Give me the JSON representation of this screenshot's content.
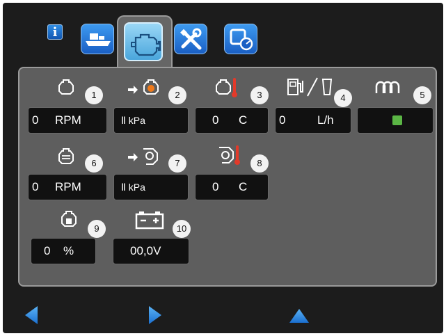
{
  "toolbar": {
    "info_label": "i",
    "tabs": [
      {
        "icon": "boat-icon",
        "selected": false
      },
      {
        "icon": "engine-icon",
        "selected": true
      },
      {
        "icon": "tools-icon",
        "selected": false
      },
      {
        "icon": "service-gauge-icon",
        "selected": false
      }
    ]
  },
  "gauges": [
    {
      "badge": "1",
      "icon": "engine-outline-icon",
      "value": "0",
      "unit": "RPM"
    },
    {
      "badge": "2",
      "icon": "oil-pressure-icon",
      "value": "",
      "unit": "Ⅱ ☢ kPa",
      "display": "Ⅱ kPa"
    },
    {
      "badge": "3",
      "icon": "engine-temperature-icon",
      "value": "0",
      "unit": "C"
    },
    {
      "badge": "4",
      "icon": "fuel-rate-icon",
      "value": "0",
      "unit": "L/h"
    },
    {
      "badge": "5",
      "icon": "glow-plug-icon",
      "indicator_color": "#5bb645"
    },
    {
      "badge": "6",
      "icon": "turbo-engine-icon",
      "value": "0",
      "unit": "RPM"
    },
    {
      "badge": "7",
      "icon": "turbo-pressure-icon",
      "value": "",
      "unit": "kPa"
    },
    {
      "badge": "8",
      "icon": "turbo-temperature-icon",
      "value": "0",
      "unit": "C"
    },
    {
      "badge": "9",
      "icon": "engine-load-icon",
      "value": "0",
      "unit": "%"
    },
    {
      "badge": "10",
      "icon": "battery-icon",
      "value": "00,0V",
      "unit": ""
    }
  ],
  "colors": {
    "screen_bg": "#1c1c1c",
    "panel_bg": "#5e5e5e",
    "value_bg": "#111111",
    "accent_blue": "#2f8de4",
    "temperature_red": "#e23a2a",
    "oil_orange": "#f07a1a",
    "indicator_green": "#5bb645"
  },
  "nav": {
    "back": "left-arrow-icon",
    "forward": "right-arrow-icon",
    "up": "up-arrow-icon"
  }
}
